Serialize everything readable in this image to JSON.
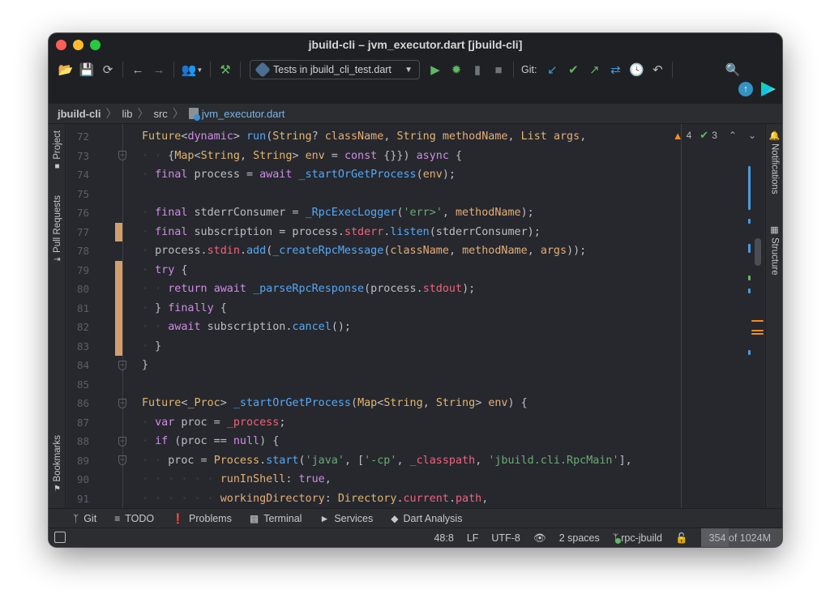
{
  "window": {
    "title": "jbuild-cli – jvm_executor.dart [jbuild-cli]"
  },
  "toolbar": {
    "icons": [
      "open-folder-icon",
      "save-icon",
      "sync-icon",
      "back-arrow-icon",
      "forward-arrow-icon",
      "user-icon",
      "build-hammer-icon"
    ],
    "run_config": "Tests in jbuild_cli_test.dart",
    "run_icons": [
      "run-icon",
      "debug-icon",
      "coverage-icon",
      "stop-icon"
    ],
    "git_label": "Git:",
    "git_icons": [
      "git-update-icon",
      "git-commit-icon",
      "git-push-icon",
      "git-merge-icon",
      "history-icon",
      "rollback-icon"
    ]
  },
  "breadcrumb": {
    "items": [
      "jbuild-cli",
      "lib",
      "src"
    ],
    "file": "jvm_executor.dart"
  },
  "left_stripe": {
    "tabs": [
      "Project",
      "Pull Requests",
      "Bookmarks"
    ]
  },
  "right_stripe": {
    "tabs": [
      "Notifications",
      "Structure"
    ]
  },
  "inspections": {
    "warnings": "4",
    "ok": "3"
  },
  "editor": {
    "lines": [
      {
        "n": "72",
        "indent": 0,
        "tokens": [
          [
            "ty",
            "Future"
          ],
          [
            "tx",
            "<"
          ],
          [
            "kw",
            "dynamic"
          ],
          [
            "tx",
            "> "
          ],
          [
            "fn",
            "run"
          ],
          [
            "tx",
            "("
          ],
          [
            "ty",
            "String"
          ],
          [
            "tx",
            "? "
          ],
          [
            "pm",
            "className"
          ],
          [
            "tx",
            ", "
          ],
          [
            "ty",
            "String"
          ],
          [
            "tx",
            " "
          ],
          [
            "pm",
            "methodName"
          ],
          [
            "tx",
            ", "
          ],
          [
            "ty",
            "List"
          ],
          [
            "tx",
            " "
          ],
          [
            "pm",
            "args"
          ],
          [
            "tx",
            ","
          ]
        ]
      },
      {
        "n": "73",
        "indent": 2,
        "tokens": [
          [
            "tx",
            "{"
          ],
          [
            "ty",
            "Map"
          ],
          [
            "tx",
            "<"
          ],
          [
            "ty",
            "String"
          ],
          [
            "tx",
            ", "
          ],
          [
            "ty",
            "String"
          ],
          [
            "tx",
            "> "
          ],
          [
            "pm",
            "env"
          ],
          [
            "tx",
            " = "
          ],
          [
            "kw",
            "const"
          ],
          [
            "tx",
            " {}}) "
          ],
          [
            "kw",
            "async"
          ],
          [
            "tx",
            " {"
          ]
        ]
      },
      {
        "n": "74",
        "indent": 1,
        "tokens": [
          [
            "kw",
            "final"
          ],
          [
            "tx",
            " process = "
          ],
          [
            "kw",
            "await"
          ],
          [
            "tx",
            " "
          ],
          [
            "fn",
            "_startOrGetProcess"
          ],
          [
            "tx",
            "("
          ],
          [
            "pm",
            "env"
          ],
          [
            "tx",
            ");"
          ]
        ]
      },
      {
        "n": "75",
        "indent": 0,
        "tokens": []
      },
      {
        "n": "76",
        "indent": 1,
        "tokens": [
          [
            "kw",
            "final"
          ],
          [
            "tx",
            " stderrConsumer = "
          ],
          [
            "fn",
            "_RpcExecLogger"
          ],
          [
            "tx",
            "("
          ],
          [
            "st",
            "'err>'"
          ],
          [
            "tx",
            ", "
          ],
          [
            "pm",
            "methodName"
          ],
          [
            "tx",
            ");"
          ]
        ]
      },
      {
        "n": "77",
        "indent": 1,
        "tokens": [
          [
            "kw",
            "final"
          ],
          [
            "tx",
            " subscription = process."
          ],
          [
            "fd",
            "stderr"
          ],
          [
            "tx",
            "."
          ],
          [
            "fn",
            "listen"
          ],
          [
            "tx",
            "(stderrConsumer);"
          ]
        ]
      },
      {
        "n": "78",
        "indent": 1,
        "tokens": [
          [
            "tx",
            "process."
          ],
          [
            "fd",
            "stdin"
          ],
          [
            "tx",
            "."
          ],
          [
            "fn",
            "add"
          ],
          [
            "tx",
            "("
          ],
          [
            "fn",
            "_createRpcMessage"
          ],
          [
            "tx",
            "("
          ],
          [
            "pm",
            "className"
          ],
          [
            "tx",
            ", "
          ],
          [
            "pm",
            "methodName"
          ],
          [
            "tx",
            ", "
          ],
          [
            "pm",
            "args"
          ],
          [
            "tx",
            "));"
          ]
        ]
      },
      {
        "n": "79",
        "indent": 1,
        "tokens": [
          [
            "kw",
            "try"
          ],
          [
            "tx",
            " {"
          ]
        ]
      },
      {
        "n": "80",
        "indent": 2,
        "tokens": [
          [
            "kw",
            "return"
          ],
          [
            "tx",
            " "
          ],
          [
            "kw",
            "await"
          ],
          [
            "tx",
            " "
          ],
          [
            "fn",
            "_parseRpcResponse"
          ],
          [
            "tx",
            "(process."
          ],
          [
            "fd",
            "stdout"
          ],
          [
            "tx",
            ");"
          ]
        ]
      },
      {
        "n": "81",
        "indent": 1,
        "tokens": [
          [
            "tx",
            "} "
          ],
          [
            "kw",
            "finally"
          ],
          [
            "tx",
            " {"
          ]
        ]
      },
      {
        "n": "82",
        "indent": 2,
        "tokens": [
          [
            "kw",
            "await"
          ],
          [
            "tx",
            " subscription."
          ],
          [
            "fn",
            "cancel"
          ],
          [
            "tx",
            "();"
          ]
        ]
      },
      {
        "n": "83",
        "indent": 1,
        "tokens": [
          [
            "tx",
            "}"
          ]
        ]
      },
      {
        "n": "84",
        "indent": 0,
        "tokens": [
          [
            "tx",
            "}"
          ]
        ]
      },
      {
        "n": "85",
        "indent": 0,
        "tokens": []
      },
      {
        "n": "86",
        "indent": 0,
        "tokens": [
          [
            "ty",
            "Future"
          ],
          [
            "tx",
            "<"
          ],
          [
            "ty",
            "_Proc"
          ],
          [
            "tx",
            "> "
          ],
          [
            "fn",
            "_startOrGetProcess"
          ],
          [
            "tx",
            "("
          ],
          [
            "ty",
            "Map"
          ],
          [
            "tx",
            "<"
          ],
          [
            "ty",
            "String"
          ],
          [
            "tx",
            ", "
          ],
          [
            "ty",
            "String"
          ],
          [
            "tx",
            "> "
          ],
          [
            "pm",
            "env"
          ],
          [
            "tx",
            ") {"
          ]
        ]
      },
      {
        "n": "87",
        "indent": 1,
        "tokens": [
          [
            "kw",
            "var"
          ],
          [
            "tx",
            " proc = "
          ],
          [
            "fd",
            "_process"
          ],
          [
            "tx",
            ";"
          ]
        ]
      },
      {
        "n": "88",
        "indent": 1,
        "tokens": [
          [
            "kw",
            "if"
          ],
          [
            "tx",
            " (proc == "
          ],
          [
            "kw",
            "null"
          ],
          [
            "tx",
            ") {"
          ]
        ]
      },
      {
        "n": "89",
        "indent": 2,
        "tokens": [
          [
            "tx",
            "proc = "
          ],
          [
            "ty",
            "Process"
          ],
          [
            "tx",
            "."
          ],
          [
            "fn",
            "start"
          ],
          [
            "tx",
            "("
          ],
          [
            "st",
            "'java'"
          ],
          [
            "tx",
            ", ["
          ],
          [
            "st",
            "'-cp'"
          ],
          [
            "tx",
            ", "
          ],
          [
            "fd",
            "_classpath"
          ],
          [
            "tx",
            ", "
          ],
          [
            "st",
            "'jbuild.cli.RpcMain'"
          ],
          [
            "tx",
            "],"
          ]
        ]
      },
      {
        "n": "90",
        "indent": 6,
        "tokens": [
          [
            "pm",
            "runInShell"
          ],
          [
            "tx",
            ": "
          ],
          [
            "kw",
            "true"
          ],
          [
            "tx",
            ","
          ]
        ]
      },
      {
        "n": "91",
        "indent": 6,
        "tokens": [
          [
            "pm",
            "workingDirectory"
          ],
          [
            "tx",
            ": "
          ],
          [
            "ty",
            "Directory"
          ],
          [
            "tx",
            "."
          ],
          [
            "fd",
            "current"
          ],
          [
            "tx",
            "."
          ],
          [
            "fd",
            "path"
          ],
          [
            "tx",
            ","
          ]
        ]
      }
    ]
  },
  "bottom_tabs": [
    {
      "label": "Git",
      "icon": "git-branch-icon"
    },
    {
      "label": "TODO",
      "icon": "list-icon"
    },
    {
      "label": "Problems",
      "icon": "problems-icon"
    },
    {
      "label": "Terminal",
      "icon": "terminal-icon"
    },
    {
      "label": "Services",
      "icon": "services-icon"
    },
    {
      "label": "Dart Analysis",
      "icon": "dart-analysis-icon"
    }
  ],
  "statusbar": {
    "position": "48:8",
    "line_separator": "LF",
    "encoding": "UTF-8",
    "indent": "2 spaces",
    "branch": "rpc-jbuild",
    "memory": "354 of 1024M",
    "memory_used_fraction": 0.346
  }
}
